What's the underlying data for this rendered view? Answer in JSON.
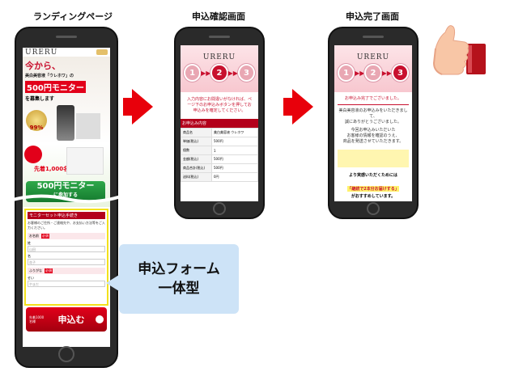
{
  "labels": {
    "lp": "ランディングページ",
    "confirm": "申込確認画面",
    "complete": "申込完了画面"
  },
  "lp": {
    "logo": "URERU",
    "headline1": "今から、",
    "headline2": "美白美容液「ウレホワ」の",
    "price": "500円モニター",
    "headline3": "を募集します",
    "badge": "99%",
    "campaign": "先着1,000名様",
    "cta_price": "500円モニター",
    "cta_suffix": "に参加する",
    "form_title": "モニターセット申込手続き",
    "form_note": "お客様のご住所・ご連絡先や、お支払い方法等をご入力ください。",
    "field_name": "お名前",
    "required": "必須",
    "field_sei": "姓",
    "ph_sei": "山田",
    "field_mei": "名",
    "ph_mei": "花子",
    "field_kana": "ふりがな",
    "kana_sei": "せい",
    "ph_kana": "やまだ",
    "bottom_cta": "申込む",
    "bottom_badge": "先着1000名様"
  },
  "confirm": {
    "logo": "URERU",
    "steps": [
      "1",
      "2",
      "3"
    ],
    "message": "入力内容にお間違いがなければ、ページ下のお申込みボタンを押してお申込みを確定してください。",
    "section": "お申込み内容",
    "rows": [
      {
        "k": "商品名",
        "v": "美白美容液 ウレホワ"
      },
      {
        "k": "単価(税込)",
        "v": "500円"
      },
      {
        "k": "個数",
        "v": "1"
      },
      {
        "k": "金額(税込)",
        "v": "500円"
      },
      {
        "k": "商品合計(税込)",
        "v": "500円"
      },
      {
        "k": "送料(税込)",
        "v": "0円"
      }
    ]
  },
  "complete": {
    "logo": "URERU",
    "steps": [
      "1",
      "2",
      "3"
    ],
    "headline": "お申込み完了でございました。",
    "lines": [
      "美白美容液のお申込みをいただきまして、",
      "誠にありがとうございました。",
      "今回お申込みいただいた",
      "お客様の情報を確認のうえ、",
      "商品を発送させていただきます。"
    ],
    "footer1": "より実感いただくためには",
    "footer2": "「継続で2本分お届けする」",
    "footer3": "がおすすめしています。"
  },
  "bubble": {
    "line1": "申込フォーム",
    "line2": "一体型"
  },
  "colors": {
    "accent_red": "#e8000b",
    "brand_red": "#c8102e",
    "bubble_blue": "#cde3f7"
  }
}
